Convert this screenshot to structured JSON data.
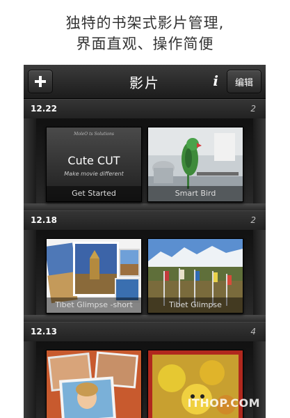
{
  "promo": {
    "line1": "独特的书架式影片管理,",
    "line2": "界面直观、操作简便"
  },
  "navbar": {
    "add_icon": "plus-icon",
    "title": "影片",
    "info_label": "i",
    "edit_label": "编辑"
  },
  "sections": [
    {
      "date": "12.22",
      "count": "2",
      "items": [
        {
          "caption": "Get Started",
          "thumb_top": "MoleO ts Solutions",
          "thumb_title": "Cute CUT",
          "thumb_subtitle": "Make movie different"
        },
        {
          "caption": "Smart Bird"
        }
      ]
    },
    {
      "date": "12.18",
      "count": "2",
      "items": [
        {
          "caption": "Tibet Glimpse -short"
        },
        {
          "caption": "Tibet Glimpse"
        }
      ]
    },
    {
      "date": "12.13",
      "count": "4",
      "items": [
        {
          "caption": ""
        },
        {
          "caption": ""
        }
      ]
    }
  ],
  "watermark": "ITHOP.COM"
}
